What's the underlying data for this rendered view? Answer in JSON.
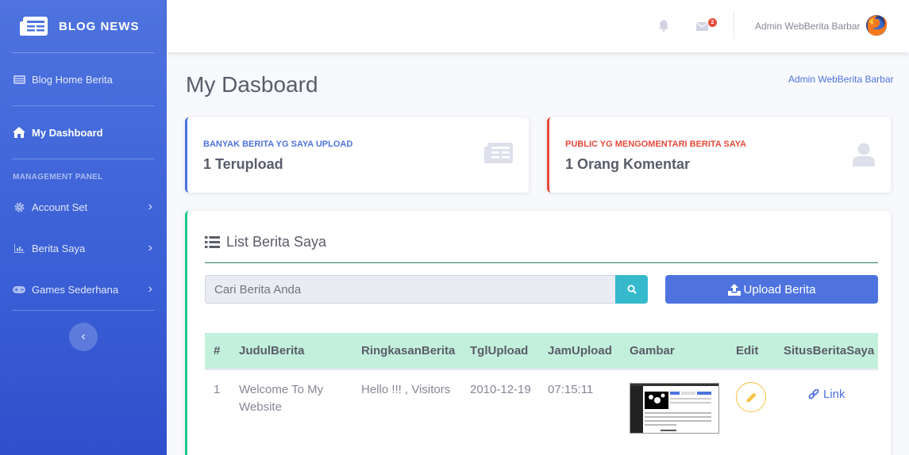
{
  "brand": {
    "name": "BLOG NEWS"
  },
  "sidebar": {
    "items": [
      {
        "label": "Blog Home Berita"
      },
      {
        "label": "My Dashboard"
      }
    ],
    "heading": "MANAGEMENT PANEL",
    "submenus": [
      {
        "label": "Account Set"
      },
      {
        "label": "Berita Saya"
      },
      {
        "label": "Games Sederhana"
      }
    ]
  },
  "topbar": {
    "mail_badge": "2",
    "user_name": "Admin WebBerita Barbar"
  },
  "page": {
    "title": "My Dasboard",
    "breadcrumb": "Admin WebBerita Barbar"
  },
  "stats": [
    {
      "label": "BANYAK BERITA YG SAYA UPLOAD",
      "value": "1 Terupload",
      "color": "#4e73df"
    },
    {
      "label": "PUBLIC YG MENGOMENTARI BERITA SAYA",
      "value": "1 Orang Komentar",
      "color": "#e74a3b"
    }
  ],
  "list": {
    "title": "List Berita Saya",
    "search_placeholder": "Cari Berita Anda",
    "upload_label": "Upload Berita",
    "columns": [
      "#",
      "JudulBerita",
      "RingkasanBerita",
      "TglUpload",
      "JamUpload",
      "Gambar",
      "Edit",
      "SitusBeritaSaya"
    ],
    "rows": [
      {
        "no": "1",
        "judul": "Welcome To My Website",
        "ringkasan": "Hello !!! , Visitors",
        "tgl": "2010-12-19",
        "jam": "07:15:11",
        "link": "Link"
      }
    ]
  },
  "colors": {
    "primary": "#4e73df",
    "danger": "#e74a3b",
    "success": "#1cc88a",
    "info": "#36b9cc",
    "warning": "#f6c23e"
  }
}
